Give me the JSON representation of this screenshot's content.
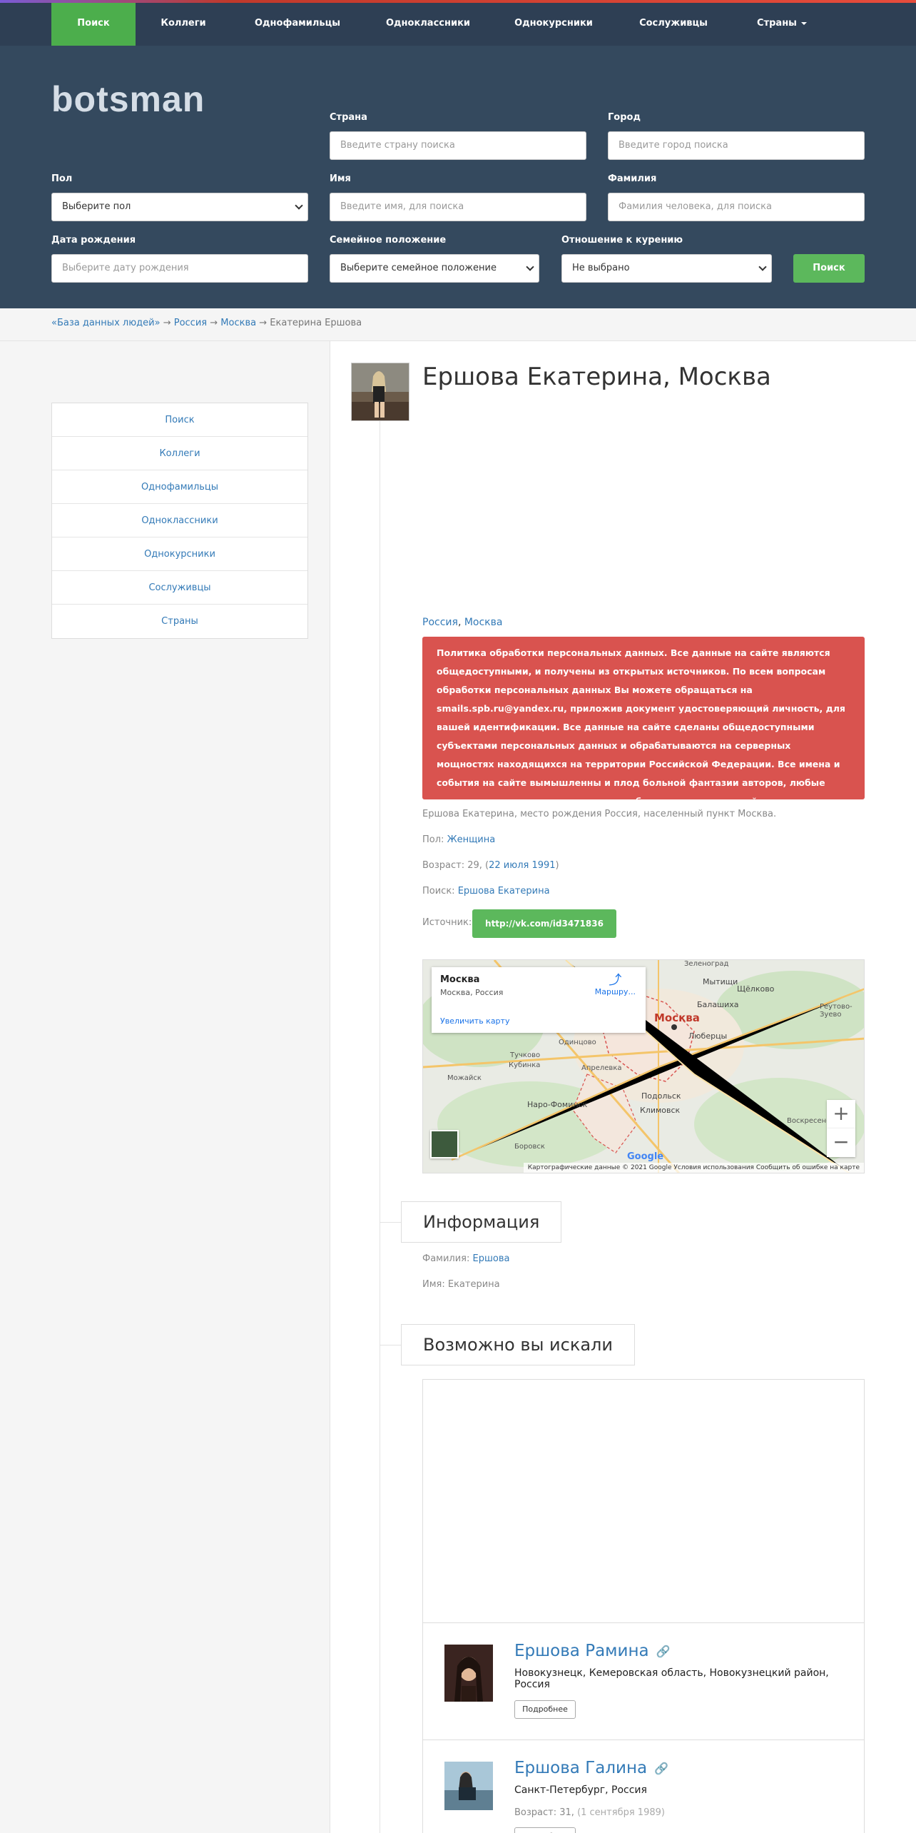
{
  "nav": {
    "items": [
      "Поиск",
      "Коллеги",
      "Однофамильцы",
      "Одноклассники",
      "Однокурсники",
      "Сослуживцы"
    ],
    "countries": "Страны"
  },
  "logo": "botsman",
  "form": {
    "country_label": "Страна",
    "country_placeholder": "Введите страну поиска",
    "city_label": "Город",
    "city_placeholder": "Введите город поиска",
    "gender_label": "Пол",
    "gender_value": "Выберите пол",
    "name_label": "Имя",
    "name_placeholder": "Введите имя, для поиска",
    "surname_label": "Фамилия",
    "surname_placeholder": "Фамилия человека, для поиска",
    "birth_label": "Дата рождения",
    "birth_placeholder": "Выберите дату рождения",
    "marital_label": "Семейное положение",
    "marital_value": "Выберите семейное положение",
    "smoking_label": "Отношение к курению",
    "smoking_value": "Не выбрано",
    "search_button": "Поиск"
  },
  "breadcrumb": {
    "root": "«База данных людей»",
    "country": "Россия",
    "city": "Москва",
    "current": "Екатерина Ершова",
    "sep": "→"
  },
  "sidebar": [
    "Поиск",
    "Коллеги",
    "Однофамильцы",
    "Одноклассники",
    "Однокурсники",
    "Сослуживцы",
    "Страны"
  ],
  "profile": {
    "title": "Ершова Екатерина, Москва",
    "country": "Россия",
    "city": "Москва",
    "alert": "Политика обработки персональных данных. Все данные на сайте являются общедоступными, и получены из открытых источников. По всем вопросам обработки персональных данных Вы можете обращаться на smails.spb.ru@yandex.ru, приложив документ удостоверяющий личность, для вашей идентификации. Все данные на сайте сделаны общедоступными субъектами персональных данных и обрабатываются на серверных мощностях находящихся на территории Российской Федерации. Все имена и события на сайте вымышленны и плод больной фантазии авторов, любые совпадения с реальными людьми и событиями чистая случайность.",
    "birthplace": "Ершова Екатерина, место рождения Россия, населенный пункт Москва.",
    "gender_label": "Пол:",
    "gender": "Женщина",
    "age_label": "Возраст: 29, (",
    "birth_date": "22 июля 1991",
    "age_close": ")",
    "search_label": "Поиск:",
    "search_link": "Ершова Екатерина",
    "source_label": "Источник:",
    "source_link": "http://vk.com/id3471836"
  },
  "map": {
    "place": "Москва",
    "place_sub": "Москва, Россия",
    "route": "Маршру...",
    "enlarge": "Увеличить карту",
    "city_marker": "Москва",
    "footer": "Картографические данные © 2021 Google   Условия использования   Сообщить об ошибке на карте",
    "google": "Google",
    "labels": [
      "Зеленоград",
      "Мытищи",
      "Балашиха",
      "Щёлково",
      "Люберцы",
      "Реутово-Зуево",
      "Одинцово",
      "Тучково",
      "Кубинка",
      "Апрелевка",
      "Можайск",
      "Наро-Фоминск",
      "Подольск",
      "Климовск",
      "Воскресенск",
      "Боровск"
    ]
  },
  "info": {
    "title": "Информация",
    "surname_label": "Фамилия:",
    "surname": "Ершова",
    "name_text": "Имя: Екатерина"
  },
  "related": {
    "title": "Возможно вы искали",
    "items": [
      {
        "name": "Ершова Рамина",
        "place": "Новокузнецк, Кемеровская область, Новокузнецкий район, Россия",
        "button": "Подробнее"
      },
      {
        "name": "Ершова Галина",
        "place": "Санкт-Петербург, Россия",
        "age": "Возраст: 31,",
        "birth": "(1 сентября 1989)",
        "button": "Подробнее"
      }
    ]
  }
}
